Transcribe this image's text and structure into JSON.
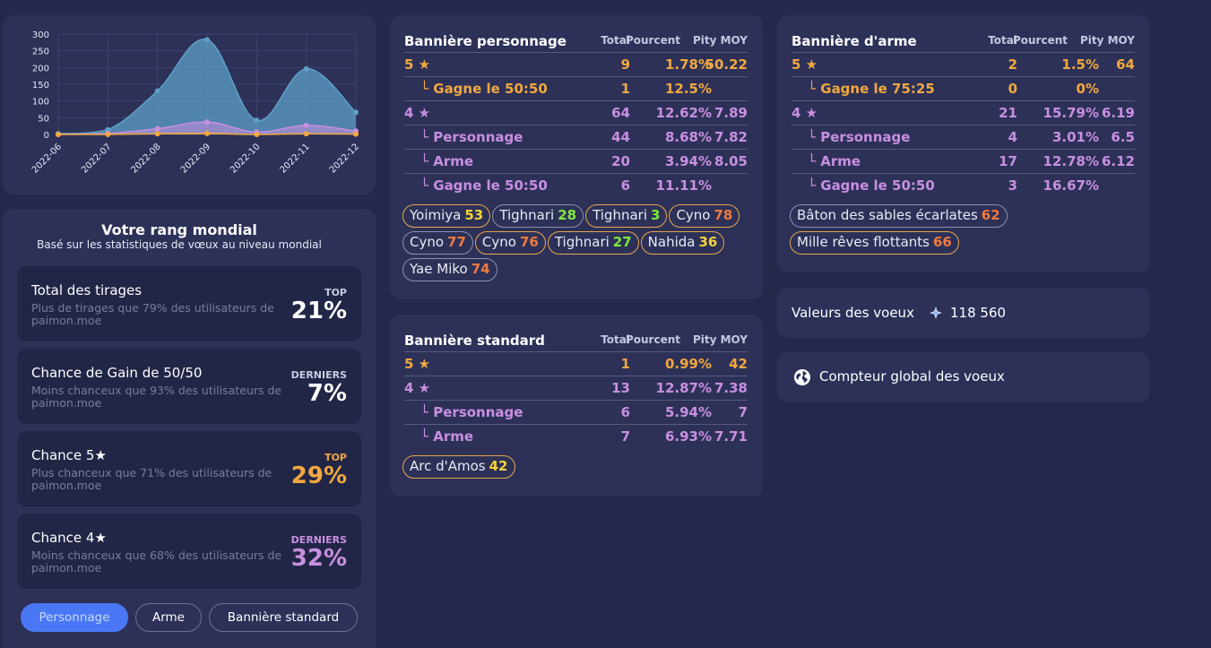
{
  "chart_data": {
    "type": "area",
    "categories": [
      "2022-06",
      "2022-07",
      "2022-08",
      "2022-09",
      "2022-10",
      "2022-11",
      "2022-12"
    ],
    "yticks": [
      "0",
      "50",
      "100",
      "150",
      "200",
      "250",
      "300"
    ],
    "ylim": [
      0,
      300
    ],
    "grid": true,
    "series": [
      {
        "color": "#5ea0c8",
        "values": [
          2,
          14,
          130,
          283,
          42,
          196,
          66
        ]
      },
      {
        "color": "#c88fe0",
        "values": [
          0,
          3,
          17,
          37,
          7,
          27,
          10
        ]
      },
      {
        "color": "#f1a83f",
        "values": [
          0,
          0,
          2,
          3,
          0,
          2,
          1
        ]
      }
    ]
  },
  "rank": {
    "title": "Votre rang mondial",
    "subtitle": "Basé sur les statistiques de vœux au niveau mondial",
    "items": [
      {
        "label": "Total des tirages",
        "desc": "Plus de tirages que 79% des utilisateurs de paimon.moe",
        "tag": "TOP",
        "value": "21%",
        "tag_color": "#c9cbe0",
        "value_color": "#ffffff"
      },
      {
        "label": "Chance de Gain de 50/50",
        "desc": "Moins chanceux que 93% des utilisateurs de paimon.moe",
        "tag": "DERNIERS",
        "value": "7%",
        "tag_color": "#c9cbe0",
        "value_color": "#ffffff"
      },
      {
        "label": "Chance 5★",
        "desc": "Plus chanceux que 71% des utilisateurs de paimon.moe",
        "tag": "TOP",
        "value": "29%",
        "tag_color": "#f1a83f",
        "value_color": "#f1a83f"
      },
      {
        "label": "Chance 4★",
        "desc": "Moins chanceux que 68% des utilisateurs de paimon.moe",
        "tag": "DERNIERS",
        "value": "32%",
        "tag_color": "#c88fe0",
        "value_color": "#c88fe0"
      }
    ],
    "tabs": [
      "Personnage",
      "Arme",
      "Bannière standard"
    ]
  },
  "columns": {
    "total": "Total",
    "percent": "Pourcent",
    "pity": "Pity MOY"
  },
  "char_banner": {
    "title": "Bannière personnage",
    "rows": [
      {
        "label": "5 ★",
        "total": "9",
        "percent": "1.78%",
        "pity": "50.22",
        "color": "gold",
        "indent": false
      },
      {
        "label": "└ Gagne le 50:50",
        "total": "1",
        "percent": "12.5%",
        "pity": "",
        "color": "gold",
        "indent": true
      },
      {
        "label": "4 ★",
        "total": "64",
        "percent": "12.62%",
        "pity": "7.89",
        "color": "pink",
        "indent": false
      },
      {
        "label": "└ Personnage",
        "total": "44",
        "percent": "8.68%",
        "pity": "7.82",
        "color": "pink",
        "indent": true
      },
      {
        "label": "└ Arme",
        "total": "20",
        "percent": "3.94%",
        "pity": "8.05",
        "color": "pink",
        "indent": true
      },
      {
        "label": "└ Gagne le 50:50",
        "total": "6",
        "percent": "11.11%",
        "pity": "",
        "color": "pink",
        "indent": true
      }
    ],
    "chips": [
      {
        "name": "Yoimiya",
        "pity": "53",
        "pity_color": "yellow",
        "border": "gold"
      },
      {
        "name": "Tighnari",
        "pity": "28",
        "pity_color": "green",
        "border": "gray"
      },
      {
        "name": "Tighnari",
        "pity": "3",
        "pity_color": "green",
        "border": "gold"
      },
      {
        "name": "Cyno",
        "pity": "78",
        "pity_color": "orange",
        "border": "gold"
      },
      {
        "name": "Cyno",
        "pity": "77",
        "pity_color": "orange",
        "border": "gray"
      },
      {
        "name": "Cyno",
        "pity": "76",
        "pity_color": "orange",
        "border": "gold"
      },
      {
        "name": "Tighnari",
        "pity": "27",
        "pity_color": "green",
        "border": "gold"
      },
      {
        "name": "Nahida",
        "pity": "36",
        "pity_color": "yellow",
        "border": "gold"
      },
      {
        "name": "Yae Miko",
        "pity": "74",
        "pity_color": "orange",
        "border": "gray"
      }
    ]
  },
  "std_banner": {
    "title": "Bannière standard",
    "rows": [
      {
        "label": "5 ★",
        "total": "1",
        "percent": "0.99%",
        "pity": "42",
        "color": "gold",
        "indent": false
      },
      {
        "label": "4 ★",
        "total": "13",
        "percent": "12.87%",
        "pity": "7.38",
        "color": "pink",
        "indent": false
      },
      {
        "label": "└ Personnage",
        "total": "6",
        "percent": "5.94%",
        "pity": "7",
        "color": "pink",
        "indent": true
      },
      {
        "label": "└ Arme",
        "total": "7",
        "percent": "6.93%",
        "pity": "7.71",
        "color": "pink",
        "indent": true
      }
    ],
    "chips": [
      {
        "name": "Arc d'Amos",
        "pity": "42",
        "pity_color": "yellow",
        "border": "gold"
      }
    ]
  },
  "weapon_banner": {
    "title": "Bannière d'arme",
    "rows": [
      {
        "label": "5 ★",
        "total": "2",
        "percent": "1.5%",
        "pity": "64",
        "color": "gold",
        "indent": false
      },
      {
        "label": "└ Gagne le 75:25",
        "total": "0",
        "percent": "0%",
        "pity": "",
        "color": "gold",
        "indent": true
      },
      {
        "label": "4 ★",
        "total": "21",
        "percent": "15.79%",
        "pity": "6.19",
        "color": "pink",
        "indent": false
      },
      {
        "label": "└ Personnage",
        "total": "4",
        "percent": "3.01%",
        "pity": "6.5",
        "color": "pink",
        "indent": true
      },
      {
        "label": "└ Arme",
        "total": "17",
        "percent": "12.78%",
        "pity": "6.12",
        "color": "pink",
        "indent": true
      },
      {
        "label": "└ Gagne le 50:50",
        "total": "3",
        "percent": "16.67%",
        "pity": "",
        "color": "pink",
        "indent": true
      }
    ],
    "chips": [
      {
        "name": "Bâton des sables écarlates",
        "pity": "62",
        "pity_color": "orange",
        "border": "gray"
      },
      {
        "name": "Mille rêves flottants",
        "pity": "66",
        "pity_color": "orange",
        "border": "gold"
      }
    ]
  },
  "wish_value": {
    "label": "Valeurs des voeux",
    "icon": "primogem-icon",
    "value": "118 560"
  },
  "global_counter": {
    "label": "Compteur global des voeux",
    "icon": "globe-icon"
  },
  "colors": {
    "gold": "#f1a83f",
    "pink": "#c88fe0",
    "accent": "#4a78f5",
    "card": "#2d3158",
    "bg": "#25284a"
  }
}
